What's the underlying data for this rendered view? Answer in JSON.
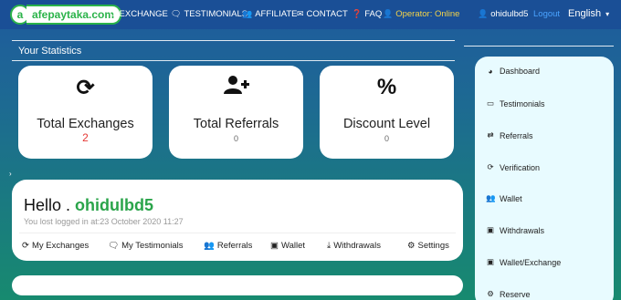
{
  "nav": {
    "logo_badge": "a",
    "logo_text": "afepaytaka.com",
    "exchange": "EXCHANGE",
    "testimonials": "TESTIMONIALS",
    "affiliate": "AFFILIATE",
    "contact": "CONTACT",
    "faq": "FAQ",
    "operator": "Operator: Online",
    "username": "ohidulbd5",
    "logout": "Logout",
    "language": "English"
  },
  "stats": {
    "title": "Your Statistics",
    "cards": [
      {
        "icon": "sync-icon",
        "glyph": "⟳",
        "label": "Total Exchanges",
        "value": "2"
      },
      {
        "icon": "user-plus-icon",
        "glyph": "👤+",
        "label": "Total Referrals",
        "value": "0"
      },
      {
        "icon": "percent-icon",
        "glyph": "%",
        "label": "Discount Level",
        "value": "0"
      }
    ]
  },
  "hello": {
    "greeting": "Hello . ",
    "username": "ohidulbd5",
    "last_login": "You lost logged in at:23 October 2020 11:27",
    "links": [
      "My Exchanges",
      "My Testimonials",
      "Referrals",
      "Wallet",
      "Withdrawals",
      "Settings"
    ]
  },
  "sidebar": {
    "items": [
      "Dashboard",
      "Testimonials",
      "Referrals",
      "Verification",
      "Wallet",
      "Withdrawals",
      "Wallet/Exchange",
      "Reserve"
    ]
  },
  "colors": {
    "nav_bg": "#1a4f96",
    "accent_green": "#2aa44a",
    "operator_yellow": "#f2d24a",
    "logout_blue": "#4aa3ff",
    "value_red": "#e53935"
  }
}
